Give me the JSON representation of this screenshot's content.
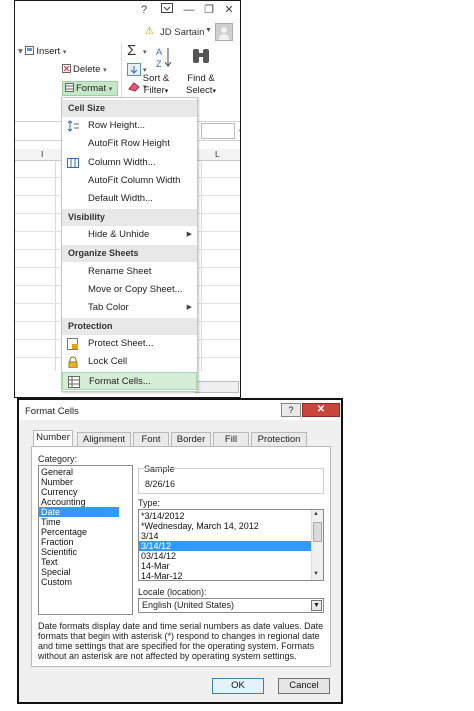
{
  "window": {
    "help": "?",
    "minimize": "—",
    "restore": "❐",
    "close": "✕"
  },
  "user": {
    "name": "JD Sartain",
    "warning_icon": "warning-icon"
  },
  "ribbon": {
    "insert": "Insert",
    "delete": "Delete",
    "format": "Format",
    "sort_filter": [
      "Sort &",
      "Filter"
    ],
    "find_select": [
      "Find &",
      "Select"
    ],
    "colors": {
      "format_highlight": "#c6e6c8",
      "menu_highlight": "#d5ecd6"
    }
  },
  "columns": {
    "i": "I",
    "l": "L"
  },
  "menu": {
    "sections": [
      {
        "header": "Cell Size",
        "items": [
          {
            "label": "Row Height...",
            "icon": "row-height-icon"
          },
          {
            "label": "AutoFit Row Height"
          },
          {
            "label": "Column Width...",
            "icon": "column-width-icon"
          },
          {
            "label": "AutoFit Column Width"
          },
          {
            "label": "Default Width..."
          }
        ]
      },
      {
        "header": "Visibility",
        "items": [
          {
            "label": "Hide & Unhide",
            "submenu": true
          }
        ]
      },
      {
        "header": "Organize Sheets",
        "items": [
          {
            "label": "Rename Sheet"
          },
          {
            "label": "Move or Copy Sheet..."
          },
          {
            "label": "Tab Color",
            "submenu": true
          }
        ]
      },
      {
        "header": "Protection",
        "items": [
          {
            "label": "Protect Sheet...",
            "icon": "protect-sheet-icon"
          },
          {
            "label": "Lock Cell",
            "icon": "lock-icon"
          },
          {
            "label": "Format Cells...",
            "icon": "format-cells-icon",
            "highlighted": true
          }
        ]
      }
    ]
  },
  "dialog": {
    "title": "Format Cells",
    "help": "?",
    "close": "✕",
    "tabs": [
      "Number",
      "Alignment",
      "Font",
      "Border",
      "Fill",
      "Protection"
    ],
    "active_tab": "Number",
    "category_label": "Category:",
    "categories": [
      "General",
      "Number",
      "Currency",
      "Accounting",
      "Date",
      "Time",
      "Percentage",
      "Fraction",
      "Scientific",
      "Text",
      "Special",
      "Custom"
    ],
    "selected_category": "Date",
    "sample_label": "Sample",
    "sample_value": "8/26/16",
    "type_label": "Type:",
    "types": [
      "*3/14/2012",
      "*Wednesday, March 14, 2012",
      "3/14",
      "3/14/12",
      "03/14/12",
      "14-Mar",
      "14-Mar-12"
    ],
    "selected_type": "3/14/12",
    "locale_label": "Locale (location):",
    "locale_value": "English (United States)",
    "description": "Date formats display date and time serial numbers as date values.  Date formats that begin with asterisk (*) respond to changes in regional date and time settings that are specified for the operating system. Formats without an asterisk are not affected by operating system settings.",
    "ok": "OK",
    "cancel": "Cancel",
    "selection_color": "#3399ff"
  }
}
